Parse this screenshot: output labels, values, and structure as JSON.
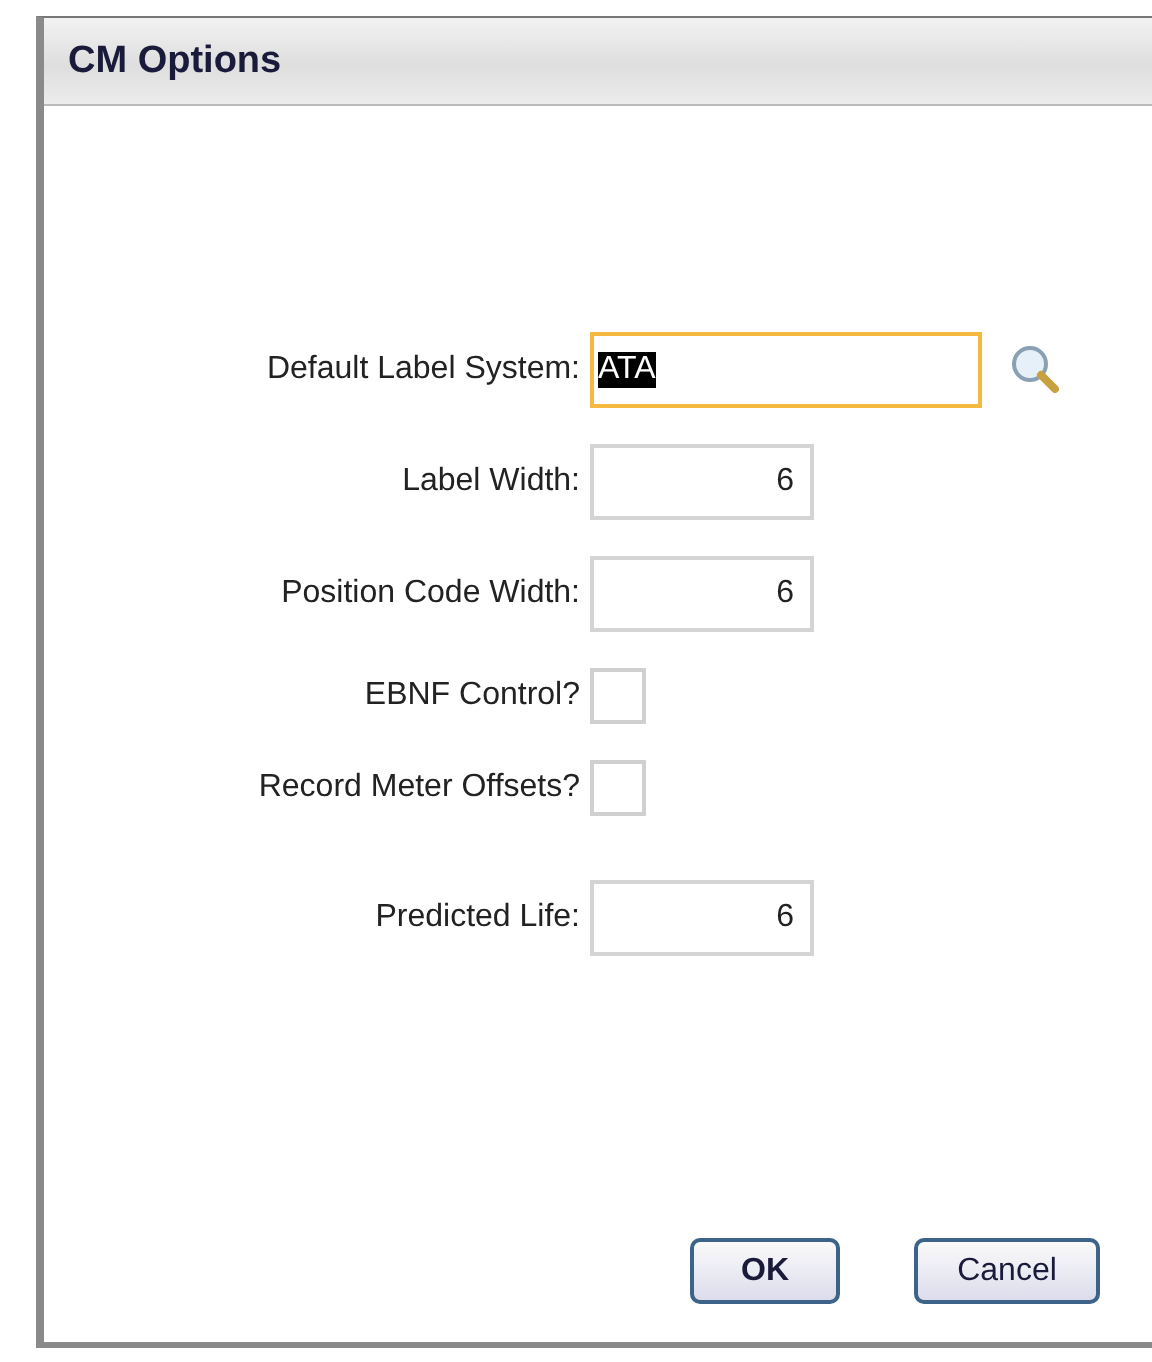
{
  "window": {
    "title": "CM Options"
  },
  "fields": [
    {
      "kind": "lookup",
      "label": "Default Label System:",
      "value": "ATA",
      "focused": true,
      "text_selected": true
    },
    {
      "kind": "number",
      "label": "Label Width:",
      "value": "6",
      "focused": false,
      "text_selected": false
    },
    {
      "kind": "number",
      "label": "Position Code Width:",
      "value": "6",
      "focused": false,
      "text_selected": false
    },
    {
      "kind": "checkbox",
      "label": "EBNF Control?",
      "checked": false
    },
    {
      "kind": "checkbox",
      "label": "Record Meter Offsets?",
      "checked": false
    },
    {
      "kind": "number",
      "label": "Predicted Life:",
      "value": "6",
      "focused": false,
      "text_selected": false
    }
  ],
  "buttons": [
    "OK",
    "Cancel"
  ]
}
